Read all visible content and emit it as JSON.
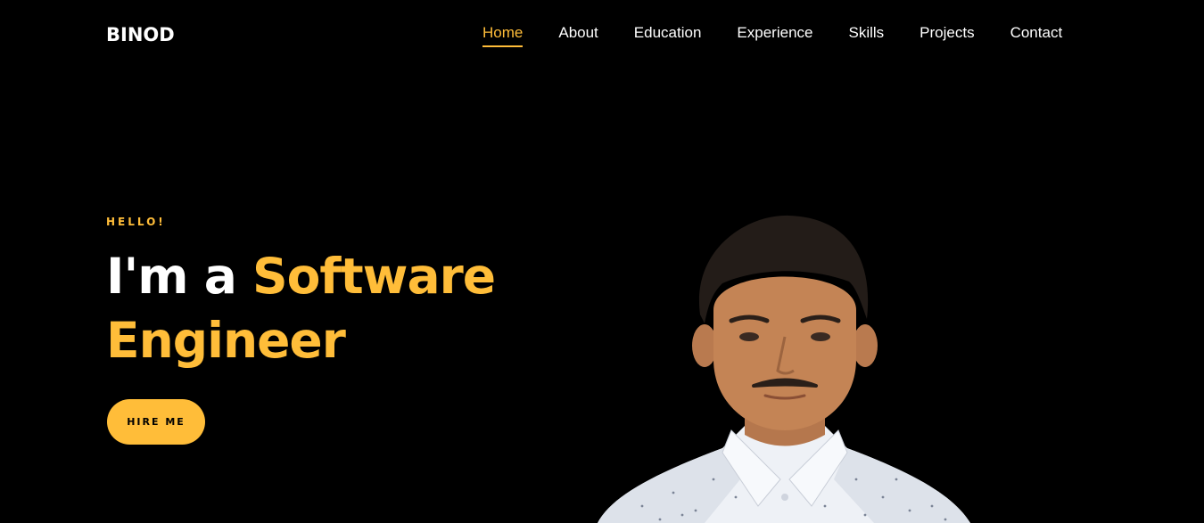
{
  "brand": {
    "name": "BINOD"
  },
  "nav": {
    "items": [
      {
        "label": "Home",
        "active": true
      },
      {
        "label": "About",
        "active": false
      },
      {
        "label": "Education",
        "active": false
      },
      {
        "label": "Experience",
        "active": false
      },
      {
        "label": "Skills",
        "active": false
      },
      {
        "label": "Projects",
        "active": false
      },
      {
        "label": "Contact",
        "active": false
      }
    ]
  },
  "hero": {
    "eyebrow": "HELLO!",
    "headline_prefix": "I'm a ",
    "headline_accent_1": "Software",
    "headline_accent_2": "Engineer",
    "cta_label": "HIRE ME"
  },
  "colors": {
    "accent": "#ffbd39",
    "background": "#000000",
    "text": "#ffffff"
  }
}
